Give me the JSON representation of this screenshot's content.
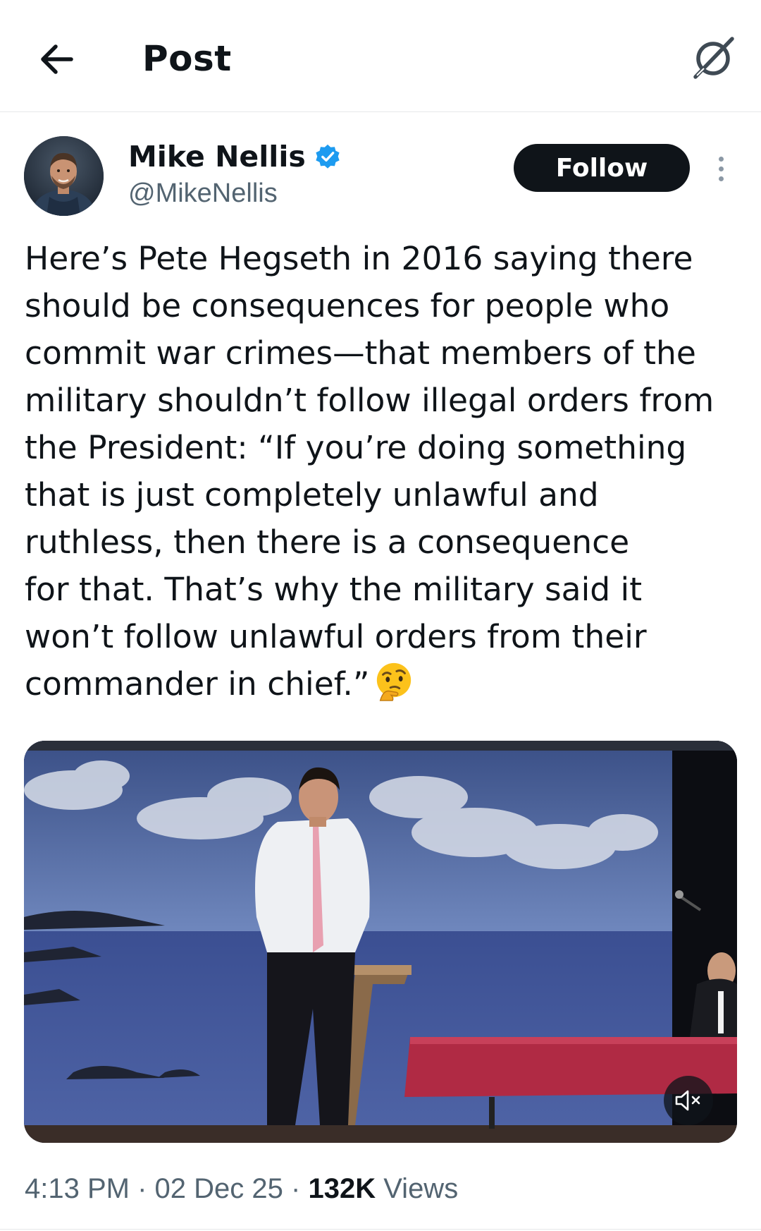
{
  "header": {
    "title": "Post",
    "back_icon": "arrow-left-icon",
    "grok_icon": "grok-icon"
  },
  "author": {
    "display_name": "Mike Nellis",
    "handle": "@MikeNellis",
    "verified": true,
    "verified_color": "#1d9bf0",
    "follow_label": "Follow",
    "more_icon": "more-vertical-icon"
  },
  "tweet": {
    "lines": [
      "Here’s Pete Hegseth in 2016 saying there",
      "should be consequences for people who",
      "commit war crimes—that members of the",
      "military shouldn’t follow illegal orders from",
      "the President: “If you’re doing something",
      "that is just completely unlawful and",
      "ruthless, then there is a consequence",
      "for that. That’s why the military said it",
      "won’t follow unlawful orders from their",
      "commander in chief.”"
    ],
    "emoji": "thinking-face-emoji"
  },
  "media": {
    "type": "video",
    "mute_icon": "speaker-muted-icon"
  },
  "meta": {
    "time": "4:13 PM",
    "separator": "·",
    "date": "02 Dec 25",
    "views_count": "132K",
    "views_label": "Views"
  },
  "colors": {
    "text_primary": "#0f1419",
    "text_secondary": "#536471",
    "button_dark": "#0f1419",
    "divider": "#e6e8ea"
  }
}
